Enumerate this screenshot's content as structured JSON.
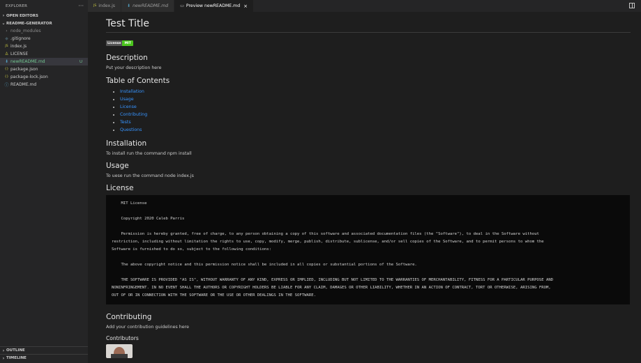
{
  "sidebar": {
    "header": "EXPLORER",
    "more_label": "···",
    "open_editors": "OPEN EDITORS",
    "project": "README-GENERATOR",
    "files": [
      {
        "name": "node_modules",
        "icon": "folder-chevron-icon",
        "glyph": "›",
        "color": "#8c8c8c",
        "dim": true
      },
      {
        "name": ".gitignore",
        "icon": "git-icon",
        "glyph": "◆",
        "color": "#41535b"
      },
      {
        "name": "index.js",
        "icon": "js-file-icon",
        "glyph": "JS",
        "color": "#cbcb41"
      },
      {
        "name": "LICENSE",
        "icon": "license-file-icon",
        "glyph": "♙",
        "color": "#cbcb41"
      },
      {
        "name": "newREADME.md",
        "icon": "markdown-file-icon",
        "glyph": "⬇",
        "color": "#519aba",
        "active": true,
        "badge": "U"
      },
      {
        "name": "package.json",
        "icon": "json-file-icon",
        "glyph": "{}",
        "color": "#cbcb41"
      },
      {
        "name": "package-lock.json",
        "icon": "json-file-icon",
        "glyph": "{}",
        "color": "#cbcb41"
      },
      {
        "name": "README.md",
        "icon": "info-file-icon",
        "glyph": "ⓘ",
        "color": "#519aba"
      }
    ],
    "outline": "OUTLINE",
    "timeline": "TIMELINE"
  },
  "tabs": [
    {
      "label": "index.js",
      "icon": "js-file-icon",
      "glyph": "JS",
      "color": "#cbcb41"
    },
    {
      "label": "newREADME.md",
      "icon": "markdown-file-icon",
      "glyph": "⬇",
      "color": "#519aba",
      "italic": true
    },
    {
      "label": "Preview newREADME.md",
      "icon": "preview-icon",
      "glyph": "▭",
      "color": "#c5c5c5",
      "active": true,
      "close": "×"
    }
  ],
  "preview": {
    "title": "Test Title",
    "badge_left": "License",
    "badge_right": "MIT",
    "description_heading": "Description",
    "description_text": "Put your description here",
    "toc_heading": "Table of Contents",
    "toc_items": [
      "Installation",
      "Usage",
      "License",
      "Contributing",
      "Tests",
      "Questions"
    ],
    "installation_heading": "Installation",
    "installation_text": "To install run the command npm install",
    "usage_heading": "Usage",
    "usage_text": "To uese run the command node index.js",
    "license_heading": "License",
    "license_lines": [
      "    MIT License",
      "",
      "    Copyright 2020 Caleb Parris",
      "",
      "    Permission is hereby granted, free of charge, to any person obtaining a copy of this software and associated documentation files (the \"Software\"), to deal in the Software without",
      "restriction, including without limitation the rights to use, copy, modify, merge, publish, distribute, sublicense, and/or sell copies of the Software, and to permit persons to whom the",
      "Software is furnished to do so, subject to the following conditions:",
      "",
      "    The above copyright notice and this permission notice shall be included in all copies or substantial portions of the Software.",
      "",
      "    THE SOFTWARE IS PROVIDED \"AS IS\", WITHOUT WARRANTY OF ANY KIND, EXPRESS OR IMPLIED, INCLUDING BUT NOT LIMITED TO THE WARRANTIES OF MERCHANTABILITY, FITNESS FOR A PARTICULAR PURPOSE AND",
      "NONINFRINGEMENT. IN NO EVENT SHALL THE AUTHORS OR COPYRIGHT HOLDERS BE LIABLE FOR ANY CLAIM, DAMAGES OR OTHER LIABILITY, WHETHER IN AN ACTION OF CONTRACT, TORT OR OTHERWISE, ARISING FROM,",
      "OUT OF OR IN CONNECTION WITH THE SOFTWARE OR THE USE OR OTHER DEALINGS IN THE SOFTWARE."
    ],
    "contributing_heading": "Contributing",
    "contributing_text": "Add your contribution guidelines here",
    "contributors_heading": "Contributors"
  },
  "colors": {
    "editor_bg": "#1e1e1e",
    "sidebar_bg": "#252526",
    "link": "#3794ff",
    "untracked": "#73c991",
    "badge_green": "#4bc51e"
  }
}
